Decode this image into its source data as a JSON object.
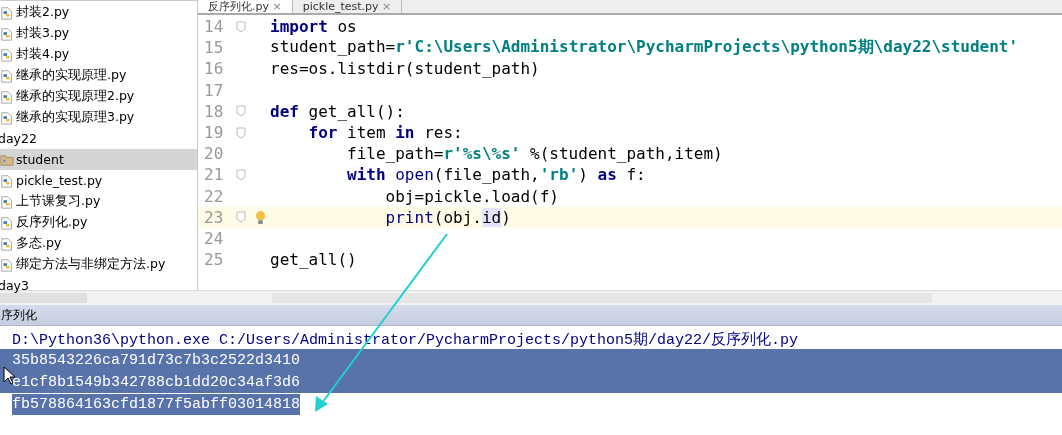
{
  "editor_tabs": [
    {
      "label": "反序列化.py",
      "close": "×",
      "selected": true
    },
    {
      "label": "pickle_test.py",
      "close": "×",
      "selected": false
    }
  ],
  "project_tree": [
    {
      "kind": "py",
      "label": "封装2.py",
      "selected": false
    },
    {
      "kind": "py",
      "label": "封装3.py",
      "selected": false
    },
    {
      "kind": "py",
      "label": "封装4.py",
      "selected": false
    },
    {
      "kind": "py",
      "label": "继承的实现原理.py",
      "selected": false
    },
    {
      "kind": "py",
      "label": "继承的实现原理2.py",
      "selected": false
    },
    {
      "kind": "py",
      "label": "继承的实现原理3.py",
      "selected": false
    },
    {
      "kind": "dir",
      "label": "day22",
      "selected": false,
      "children": [
        {
          "kind": "folder",
          "label": "student",
          "selected": true
        },
        {
          "kind": "py",
          "label": "pickle_test.py",
          "selected": false
        },
        {
          "kind": "py",
          "label": "上节课复习.py",
          "selected": false
        },
        {
          "kind": "py",
          "label": "反序列化.py",
          "selected": false
        },
        {
          "kind": "py",
          "label": "多态.py",
          "selected": false
        },
        {
          "kind": "py",
          "label": "绑定方法与非绑定方法.py",
          "selected": false
        }
      ]
    },
    {
      "kind": "dir",
      "label": "day3",
      "selected": false
    }
  ],
  "code": [
    {
      "number": "14",
      "current": false,
      "tokens": [
        {
          "kind": "keyword",
          "text": "import"
        },
        {
          "kind": "plain",
          "text": " os"
        }
      ]
    },
    {
      "number": "15",
      "current": false,
      "tokens": [
        {
          "kind": "plain",
          "text": "student_path="
        },
        {
          "kind": "string",
          "text": "r'C:\\Users\\Administrator\\PycharmProjects\\python5期\\day22\\student'"
        }
      ]
    },
    {
      "number": "16",
      "current": false,
      "tokens": [
        {
          "kind": "plain",
          "text": "res=os.listdir(student_path)"
        }
      ]
    },
    {
      "number": "17",
      "current": false
    },
    {
      "number": "18",
      "current": false,
      "tokens": [
        {
          "kind": "keyword",
          "text": "def"
        },
        {
          "kind": "plain",
          "text": " get_all():"
        }
      ]
    },
    {
      "number": "19",
      "current": false,
      "tokens": [
        {
          "kind": "keyword",
          "text": "    for"
        },
        {
          "kind": "plain",
          "text": " item "
        },
        {
          "kind": "keyword",
          "text": "in"
        },
        {
          "kind": "plain",
          "text": " res:"
        }
      ]
    },
    {
      "number": "20",
      "current": false,
      "tokens": [
        {
          "kind": "plain",
          "text": "        file_path="
        },
        {
          "kind": "string",
          "text": "r'%s\\%s'"
        },
        {
          "kind": "plain",
          "text": " %(student_path,item)"
        }
      ]
    },
    {
      "number": "21",
      "current": false,
      "tokens": [
        {
          "kind": "keyword",
          "text": "        with"
        },
        {
          "kind": "builtin",
          "text": " open"
        },
        {
          "kind": "plain",
          "text": "(file_path,"
        },
        {
          "kind": "string",
          "text": "'rb'"
        },
        {
          "kind": "plain",
          "text": ") "
        },
        {
          "kind": "keyword",
          "text": "as"
        },
        {
          "kind": "plain",
          "text": " f:"
        }
      ]
    },
    {
      "number": "22",
      "current": false,
      "tokens": [
        {
          "kind": "plain",
          "text": "            obj=pickle.load(f)"
        }
      ]
    },
    {
      "number": "23",
      "current": true,
      "tokens": [
        {
          "kind": "builtin",
          "text": "            print"
        },
        {
          "kind": "plain",
          "text": "(obj."
        },
        {
          "kind": "match",
          "text": "id"
        },
        {
          "kind": "plain",
          "text": ")"
        }
      ]
    },
    {
      "number": "24",
      "current": false
    },
    {
      "number": "25",
      "current": false,
      "tokens": [
        {
          "kind": "plain",
          "text": "get_all()"
        }
      ]
    }
  ],
  "run_panel": {
    "title": "序列化",
    "command": "D:\\Python36\\python.exe C:/Users/Administrator/PycharmProjects/python5期/day22/反序列化.py",
    "output": [
      {
        "text": "35b8543226ca791d73c7b3c2522d3410",
        "selected": true
      },
      {
        "text": "e1cf8b1549b342788cb1dd20c34af3d6",
        "selected": true
      },
      {
        "text": "fb578864163cfd1877f5abff03014818",
        "selected": true
      }
    ]
  }
}
